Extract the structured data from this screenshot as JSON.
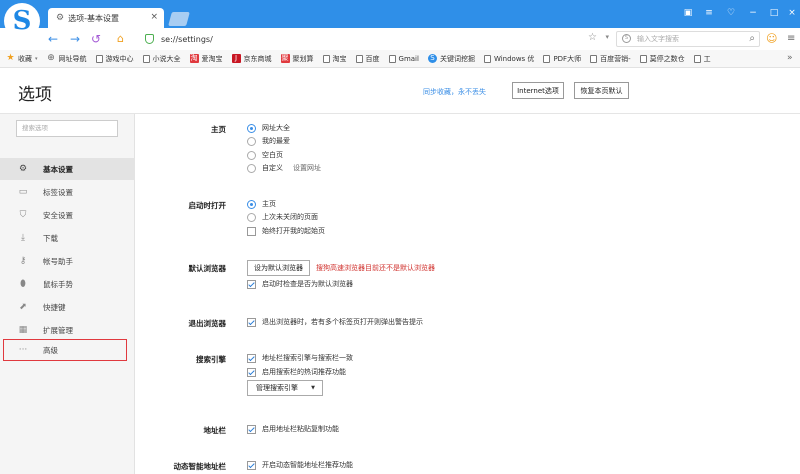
{
  "browser": {
    "tab_title": "选项-基本设置",
    "tab_close": "×",
    "url": "se://settings/",
    "search_placeholder": "输入文字搜索"
  },
  "window_controls": [
    "▣",
    "≡",
    "♡",
    "−",
    "□",
    "×"
  ],
  "bookmarks": [
    {
      "label": "收藏",
      "icon": "star-icon"
    },
    {
      "label": "网址导航",
      "icon": "globe-icon"
    },
    {
      "label": "游戏中心",
      "icon": "doc-icon"
    },
    {
      "label": "小说大全",
      "icon": "doc-icon"
    },
    {
      "label": "爱淘宝",
      "icon": "taobao-icon"
    },
    {
      "label": "京东商城",
      "icon": "jd-icon"
    },
    {
      "label": "聚划算",
      "icon": "juhuasuan-icon"
    },
    {
      "label": "淘宝",
      "icon": "doc-icon"
    },
    {
      "label": "百度",
      "icon": "doc-icon"
    },
    {
      "label": "Gmail",
      "icon": "doc-icon"
    },
    {
      "label": "关键词挖掘",
      "icon": "sogou-icon"
    },
    {
      "label": "Windows 优",
      "icon": "doc-icon"
    },
    {
      "label": "PDF大师",
      "icon": "doc-icon"
    },
    {
      "label": "百度营销-",
      "icon": "doc-icon"
    },
    {
      "label": "莫停之数仓",
      "icon": "doc-icon"
    },
    {
      "label": "工",
      "icon": "doc-icon"
    }
  ],
  "bookmarks_more": "»",
  "header": {
    "title": "选项",
    "sync_link": "同步收藏，永不丢失",
    "internet_options": "Internet选项",
    "restore_defaults": "恢复本页默认"
  },
  "sidebar": {
    "search_placeholder": "搜索选项",
    "items": [
      {
        "label": "基本设置",
        "icon": "gear-icon"
      },
      {
        "label": "标签设置",
        "icon": "tab-icon"
      },
      {
        "label": "安全设置",
        "icon": "shield-icon"
      },
      {
        "label": "下载",
        "icon": "download-icon"
      },
      {
        "label": "帐号助手",
        "icon": "key-icon"
      },
      {
        "label": "鼠标手势",
        "icon": "mouse-icon"
      },
      {
        "label": "快捷键",
        "icon": "shortcut-icon"
      },
      {
        "label": "扩展管理",
        "icon": "extension-icon"
      },
      {
        "label": "高级",
        "icon": "more-icon"
      }
    ]
  },
  "sections": {
    "homepage": {
      "label": "主页",
      "options": [
        "网址大全",
        "我的最爱",
        "空白页",
        "自定义"
      ],
      "custom_link": "设置网址",
      "selected": "网址大全"
    },
    "startup": {
      "label": "启动时打开",
      "options": [
        "主页",
        "上次未关闭的页面"
      ],
      "always_open": "始终打开我的起始页",
      "selected": "主页"
    },
    "default_browser": {
      "label": "默认浏览器",
      "button": "设为默认浏览器",
      "warning": "搜狗高速浏览器目前还不是默认浏览器",
      "check_on_start": "启动时检查是否为默认浏览器"
    },
    "exit_browser": {
      "label": "退出浏览器",
      "warn_multi_tabs": "退出浏览器时，若有多个标签页打开则弹出警告提示"
    },
    "search_engine": {
      "label": "搜索引擎",
      "sync_with_bar": "地址栏搜索引擎与搜索栏一致",
      "hot_words": "启用搜索栏的热词推荐功能",
      "manage_button": "管理搜索引擎",
      "dropdown_arrow": "▼"
    },
    "address_bar": {
      "label": "地址栏",
      "paste_copy": "启用地址栏粘贴复制功能"
    },
    "smart_address_bar": {
      "label": "动态智能地址栏",
      "enable": "开启动态智能地址栏推荐功能"
    }
  },
  "colors": {
    "titlebar": "#2f8fe8",
    "accent": "#3a8ee6",
    "warning": "#d0312d",
    "highlight_border": "#e0393e"
  }
}
